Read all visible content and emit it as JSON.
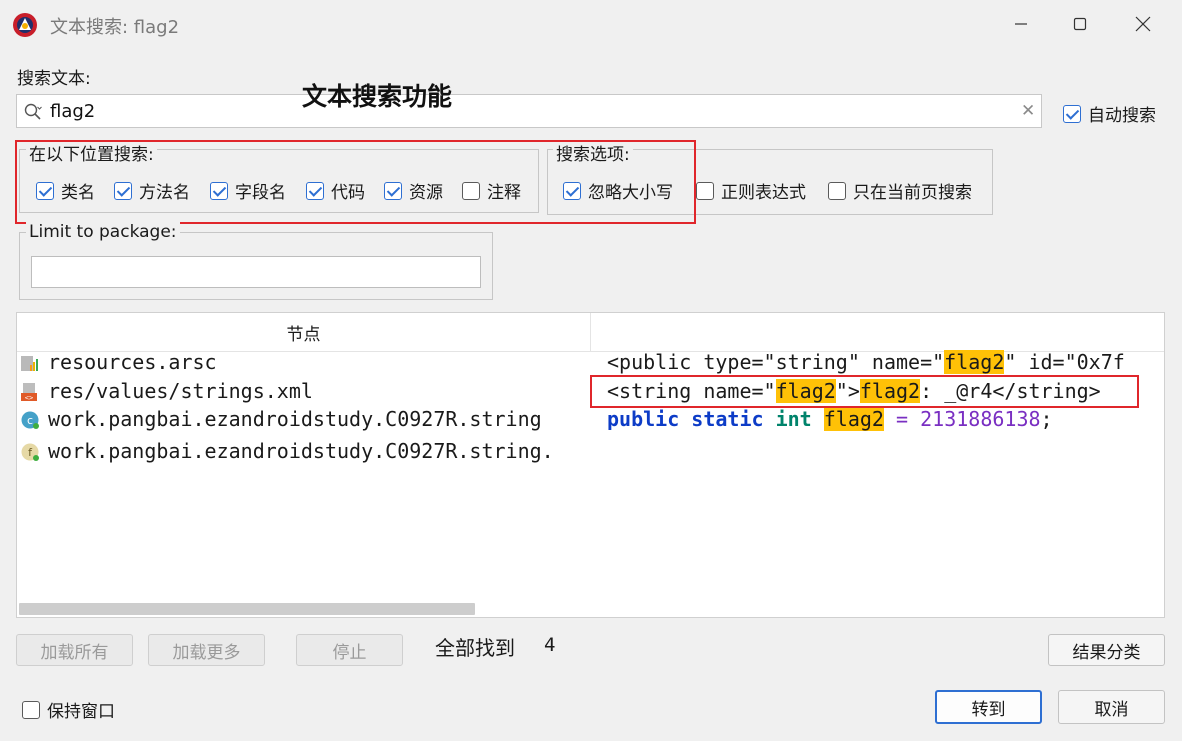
{
  "window": {
    "title": "文本搜索: flag2"
  },
  "search": {
    "label": "搜索文本:",
    "value": "flag2",
    "auto_search_label": "自动搜索",
    "auto_search_checked": true
  },
  "annotation": {
    "title": "文本搜索功能"
  },
  "search_in": {
    "legend": "在以下位置搜索:",
    "options": [
      {
        "label": "类名",
        "checked": true
      },
      {
        "label": "方法名",
        "checked": true
      },
      {
        "label": "字段名",
        "checked": true
      },
      {
        "label": "代码",
        "checked": true
      },
      {
        "label": "资源",
        "checked": true
      },
      {
        "label": "注释",
        "checked": false
      }
    ]
  },
  "search_options": {
    "legend": "搜索选项:",
    "options": [
      {
        "label": "忽略大小写",
        "checked": true
      },
      {
        "label": "正则表达式",
        "checked": false
      },
      {
        "label": "只在当前页搜索",
        "checked": false
      }
    ]
  },
  "package": {
    "legend": "Limit to package:",
    "value": ""
  },
  "results": {
    "column_node": "节点",
    "rows": [
      {
        "node": "resources.arsc",
        "icon": "arsc-resource-icon",
        "code": [
          {
            "t": "<public type=\"string\" name=\""
          },
          {
            "t": "flag2",
            "c": "hl"
          },
          {
            "t": "\" id=\"0x7f"
          }
        ]
      },
      {
        "node": "res/values/strings.xml",
        "icon": "xml-file-icon",
        "code": [
          {
            "t": "<string name=\""
          },
          {
            "t": "flag2",
            "c": "hl"
          },
          {
            "t": "\">"
          },
          {
            "t": "flag2",
            "c": "hl"
          },
          {
            "t": ": _@r4</string>"
          }
        ]
      },
      {
        "node": "work.pangbai.ezandroidstudy.C0927R.string",
        "icon": "class-icon",
        "code": [
          {
            "t": "public",
            "c": "kw"
          },
          {
            "t": " "
          },
          {
            "t": "static",
            "c": "kw"
          },
          {
            "t": " "
          },
          {
            "t": "int",
            "c": "ty"
          },
          {
            "t": " "
          },
          {
            "t": "flag2",
            "c": "hl"
          },
          {
            "t": " "
          },
          {
            "t": "=",
            "c": "op"
          },
          {
            "t": " "
          },
          {
            "t": "2131886138",
            "c": "num"
          },
          {
            "t": ";"
          }
        ]
      },
      {
        "node": "work.pangbai.ezandroidstudy.C0927R.string.",
        "icon": "field-icon",
        "code": []
      }
    ]
  },
  "buttons": {
    "load_all": "加载所有",
    "load_more": "加载更多",
    "stop": "停止",
    "group_results": "结果分类",
    "goto": "转到",
    "cancel": "取消"
  },
  "status": {
    "found_label": "全部找到",
    "found_count": "4"
  },
  "keep_window": {
    "label": "保持窗口",
    "checked": false
  },
  "colors": {
    "highlight": "#ffc107",
    "annotation_box": "#e0262b",
    "accent": "#2e6fd2"
  }
}
